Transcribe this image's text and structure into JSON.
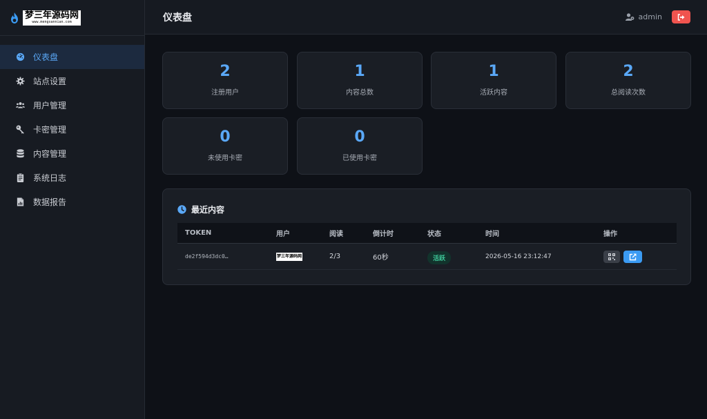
{
  "brand": {
    "logo_text": "梦三年源码网",
    "logo_subtext": "www.mengsannian.com"
  },
  "sidebar": {
    "items": [
      {
        "label": "仪表盘",
        "icon": "dashboard-icon",
        "active": true
      },
      {
        "label": "站点设置",
        "icon": "gear-icon",
        "active": false
      },
      {
        "label": "用户管理",
        "icon": "users-icon",
        "active": false
      },
      {
        "label": "卡密管理",
        "icon": "key-icon",
        "active": false
      },
      {
        "label": "内容管理",
        "icon": "database-icon",
        "active": false
      },
      {
        "label": "系统日志",
        "icon": "clipboard-icon",
        "active": false
      },
      {
        "label": "数据报告",
        "icon": "report-file-icon",
        "active": false
      }
    ]
  },
  "header": {
    "title": "仪表盘",
    "user": "admin"
  },
  "stats": [
    {
      "value": "2",
      "label": "注册用户"
    },
    {
      "value": "1",
      "label": "内容总数"
    },
    {
      "value": "1",
      "label": "活跃内容"
    },
    {
      "value": "2",
      "label": "总阅读次数"
    },
    {
      "value": "0",
      "label": "未使用卡密"
    },
    {
      "value": "0",
      "label": "已使用卡密"
    }
  ],
  "recent": {
    "title": "最近内容",
    "columns": [
      "TOKEN",
      "用户",
      "阅读",
      "倒计时",
      "状态",
      "时间",
      "操作"
    ],
    "rows": [
      {
        "token": "de2f594d3dc0…",
        "user_logo": "梦三年源码网",
        "reads": "2/3",
        "countdown": "60秒",
        "status": "活跃",
        "time": "2026-05-16 23:12:47"
      }
    ]
  },
  "colors": {
    "accent": "#5aa8f7",
    "danger": "#f0544f",
    "success": "#3ec99a",
    "background": "#0e1117",
    "card": "#1a1e25"
  }
}
